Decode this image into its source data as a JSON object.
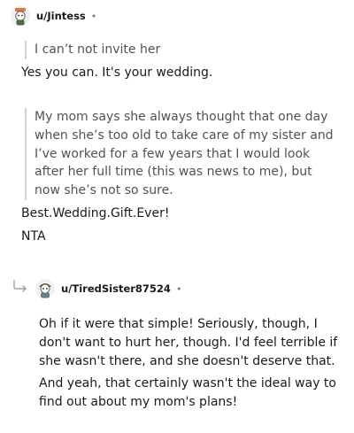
{
  "comment1": {
    "username": "u/Jintess",
    "separator": "•",
    "quote1": "I can’t not invite her",
    "para1": "Yes you can. It's your wedding.",
    "quote2_lines": [
      "My mom says she always thought that one day",
      "when she’s too old to take care of my sister and",
      "I’ve worked for a few years that I would look",
      "after her full time (this was news to me), but",
      "now she’s not so sure."
    ],
    "para2": "Best.Wedding.Gift.Ever!",
    "para3": "NTA"
  },
  "reply": {
    "username": "u/TiredSister87524",
    "separator": "•",
    "para1_lines": [
      "Oh if it were that simple! Seriously, though, I",
      "don't want to hurt her, though. I'd feel terrible if",
      "she wasn't there, and she doesn't deserve that."
    ],
    "para2_lines": [
      "And yeah, that certainly wasn't the ideal way to",
      "find out about my mom's plans!"
    ]
  },
  "icons": {
    "reply_arrow": "reply-arrow-icon",
    "avatar1": "snoo-avatar-icon",
    "avatar2": "snoo-avatar-icon"
  }
}
